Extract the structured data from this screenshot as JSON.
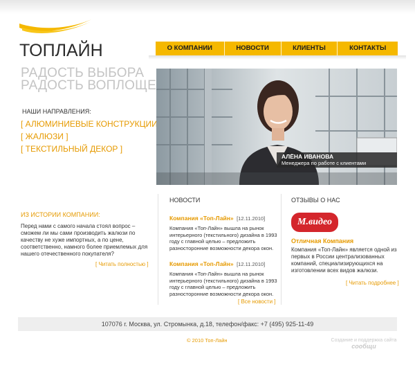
{
  "brand": {
    "logo_text": "ТОПЛАЙН",
    "accent": "#f5b800",
    "link_color": "#e69a00"
  },
  "nav": {
    "items": [
      "О КОМПАНИИ",
      "НОВОСТИ",
      "КЛИЕНТЫ",
      "КОНТАКТЫ"
    ]
  },
  "slogan": {
    "line1": "РАДОСТЬ ВЫБОРА",
    "line2": "РАДОСТЬ ВОПЛОЩЕНИЯ"
  },
  "directions": {
    "title": "НАШИ НАПРАВЛЕНИЯ:",
    "items": [
      "[ АЛЮМИНИЕВЫЕ КОНСТРУКЦИИ ]",
      "[ ЖАЛЮЗИ ]",
      "[ ТЕКСТИЛЬНЫЙ ДЕКОР ]"
    ]
  },
  "hero": {
    "name": "АЛЁНА ИВАНОВА",
    "role": "Менеджера по работе с клиентами"
  },
  "history": {
    "title": "ИЗ ИСТОРИИ КОМПАНИИ:",
    "text": "Перед нами с самого начала стоял вопрос – сможем ли мы сами производить жалюзи по качеству не хуже импортных, а по цене, соответственно, намного более приемлемых для нашего отечественного покупателя?",
    "more": "[ Читать полностью ]"
  },
  "news": {
    "title": "НОВОСТИ",
    "items": [
      {
        "headline": "Компания «Топ-Лайн»",
        "date": "[12.11.2010]",
        "text": "Компания «Топ-Лайн» вышла на рынок интерьерного (текстильного) дизайна в 1993 году с главной целью – предложить разносторонние возможности декора окон."
      },
      {
        "headline": "Компания «Топ-Лайн»",
        "date": "[12.11.2010]",
        "text": "Компания «Топ-Лайн» вышла на рынок интерьерного (текстильного) дизайна в 1993 году с главной целью – предложить разносторонние возможности декора окон."
      }
    ],
    "more": "[ Все новости ]"
  },
  "reviews": {
    "title": "ОТЗЫВЫ О НАС",
    "logo_text": "М.видео",
    "headline": "Отличная Компания",
    "text": "Компания «Топ-Лайн» является одной из первых в России централизованных компаний, специализирующихся на изготовлении всех видов жалюзи.",
    "more": "[ Читать подробнее ]"
  },
  "footer": {
    "address": "107076 г. Москва, ул. Стромынка, д.18, телефон/факс: +7 (495) 925-11-49",
    "copyright": "© 2010 Топ-Лайн",
    "credit_line": "Создание и поддержка сайта",
    "credit_brand": "сообщи"
  }
}
